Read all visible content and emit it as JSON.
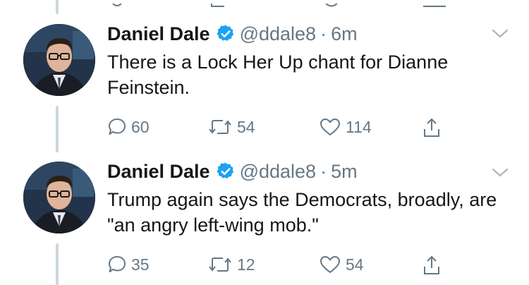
{
  "tweets": [
    {
      "name": "Daniel Dale",
      "handle": "@ddale8",
      "separator": "·",
      "time": "6m",
      "text": "There is a Lock Her Up chant for Dianne Feinstein.",
      "replies": "60",
      "retweets": "54",
      "likes": "114"
    },
    {
      "name": "Daniel Dale",
      "handle": "@ddale8",
      "separator": "·",
      "time": "5m",
      "text": "Trump again says the Democrats, broadly, are \"an angry left-wing mob.\"",
      "replies": "35",
      "retweets": "12",
      "likes": "54"
    }
  ],
  "colors": {
    "verified": "#1da1f2",
    "secondary_text": "#657786",
    "thread_line": "#ccd6dd"
  },
  "icons": [
    "verified-icon",
    "chevron-down-icon",
    "reply-icon",
    "retweet-icon",
    "like-icon",
    "share-icon"
  ]
}
